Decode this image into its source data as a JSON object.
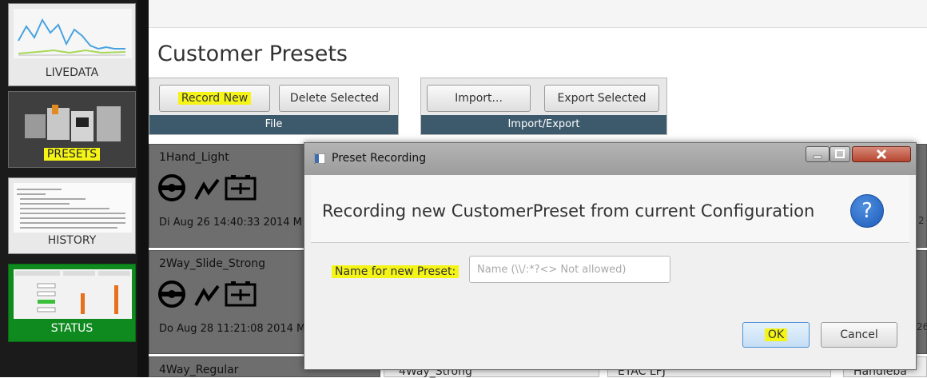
{
  "sidebar": {
    "items": [
      {
        "label": "LIVEDATA"
      },
      {
        "label": "PRESETS"
      },
      {
        "label": "HISTORY"
      },
      {
        "label": "STATUS"
      }
    ]
  },
  "page_title": "Customer Presets",
  "toolbar": {
    "file_group": {
      "record_new": "Record New",
      "delete_selected": "Delete Selected",
      "caption": "File"
    },
    "import_export_group": {
      "import": "Import...",
      "export_selected": "Export Selected",
      "caption": "Import/Export"
    }
  },
  "presets": [
    {
      "name": "1Hand_Light",
      "date": "Di Aug 26 14:40:33 2014 M"
    },
    {
      "name": "2Way_Slide_Strong",
      "date": "Do Aug 28 11:21:08 2014 M"
    },
    {
      "name": "4Way_Regular"
    }
  ],
  "partial_cards": [
    {
      "fragment_top": "2",
      "fragment_mid": "2"
    },
    {
      "fragment_top": "26",
      "fragment_mid": "26"
    },
    {
      "fragment_bottom_1": "4Way_Strong",
      "fragment_bottom_2": "ETAC LFJ",
      "fragment_bottom_3": "Handleba"
    }
  ],
  "dialog": {
    "title": "Preset Recording",
    "message": "Recording new CustomerPreset from current Configuration",
    "field_label": "Name for new Preset:",
    "field_placeholder": "Name (\\\\/:*?<> Not allowed)",
    "field_value": "",
    "ok": "OK",
    "cancel": "Cancel"
  },
  "colors": {
    "highlight": "#f4f417",
    "status_green": "#0f8a1e",
    "group_footer": "#3d5a6c",
    "help_blue": "#1c5bb8"
  }
}
